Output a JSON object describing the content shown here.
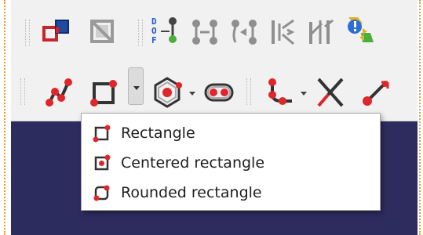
{
  "menu": {
    "items": [
      {
        "label": "Rectangle",
        "icon": "rectangle-icon"
      },
      {
        "label": "Centered rectangle",
        "icon": "centered-rectangle-icon"
      },
      {
        "label": "Rounded rectangle",
        "icon": "rounded-rectangle-icon"
      }
    ]
  },
  "toolbar_top": {
    "icons": [
      "map-sketch-icon",
      "close-shape-disabled-icon",
      "constrain-dof-icon",
      "constrain-coincident-icon",
      "constrain-point-onto-object-icon",
      "constrain-horizontal-distance-icon",
      "constrain-vertical-distance-icon",
      "toggle-driving-icon"
    ],
    "dof_letters": [
      "D",
      "O",
      "F"
    ]
  },
  "toolbar_bottom": {
    "icons": [
      "polyline-icon",
      "rectangle-tool-icon",
      "dropdown-arrow-icon",
      "polygon-icon",
      "slot-icon",
      "fillet-icon",
      "trim-icon",
      "extend-icon"
    ]
  },
  "colors": {
    "accent_red": "#e0262a",
    "icon_dark": "#333333",
    "icon_gray": "#8f8f8f",
    "workspace": "#2d2c5e",
    "border_dotted": "#e89a3c"
  }
}
